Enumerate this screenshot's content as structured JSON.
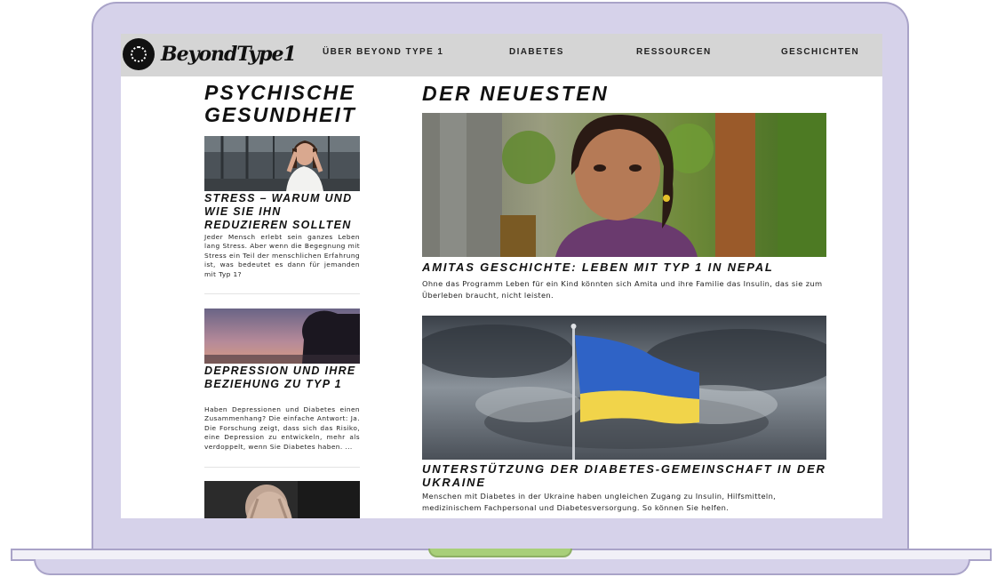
{
  "nav": {
    "logo_text": "BeyondType1",
    "items": [
      "ÜBER BEYOND TYPE 1",
      "DIABETES",
      "RESSOURCEN",
      "GESCHICHTEN"
    ]
  },
  "sidebar": {
    "heading_line1": "PSYCHISCHE",
    "heading_line2": "GESUNDHEIT",
    "articles": [
      {
        "title": "STRESS – WARUM UND WIE SIE IHN REDUZIEREN SOLLTEN",
        "text": "Jeder Mensch erlebt sein ganzes Leben lang Stress. Aber wenn die Begegnung mit Stress ein Teil der menschlichen Erfahrung ist, was bedeutet es dann für jemanden mit Typ 1?"
      },
      {
        "title": "DEPRESSION UND IHRE BEZIEHUNG ZU TYP 1",
        "text": "Haben Depressionen und Diabetes einen Zusammenhang? Die einfache Antwort: Ja. Die Forschung zeigt, dass sich das Risiko, eine Depression zu entwickeln, mehr als verdoppelt, wenn Sie Diabetes haben. ..."
      }
    ]
  },
  "main": {
    "heading": "DER NEUESTEN",
    "articles": [
      {
        "title": "AMITAS GESCHICHTE: LEBEN MIT TYP 1 IN NEPAL",
        "text": "Ohne das Programm Leben für ein Kind könnten sich Amita und ihre Familie das Insulin, das sie zum Überleben braucht, nicht leisten."
      },
      {
        "title": "UNTERSTÜTZUNG DER DIABETES-GEMEINSCHAFT IN DER UKRAINE",
        "text": "Menschen mit Diabetes in der Ukraine haben ungleichen Zugang zu Insulin, Hilfsmitteln, medizinischem Fachpersonal und Diabetesversorgung. So können Sie helfen."
      }
    ]
  },
  "colors": {
    "laptop_frame": "#d6d2ea",
    "laptop_outline": "#a9a3c8",
    "laptop_notch": "#a8cf79",
    "navbar_bg": "#d5d5d5",
    "text": "#111111"
  }
}
